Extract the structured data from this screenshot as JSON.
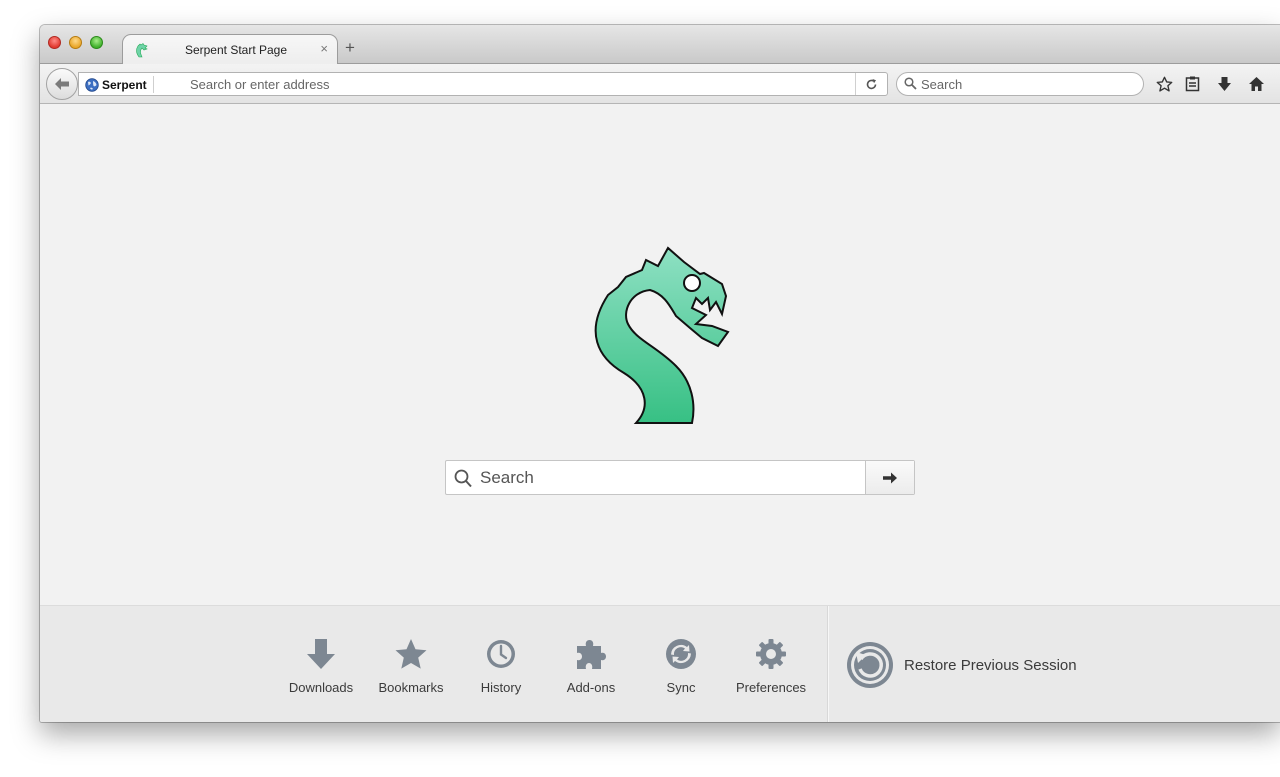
{
  "tab": {
    "title": "Serpent Start Page",
    "close_glyph": "×",
    "new_tab_glyph": "+"
  },
  "navbar": {
    "identity_label": "Serpent",
    "url_placeholder": "Search or enter address",
    "search_placeholder": "Search"
  },
  "content": {
    "search_placeholder": "Search"
  },
  "launcher": {
    "items": [
      {
        "label": "Downloads",
        "icon": "download-icon"
      },
      {
        "label": "Bookmarks",
        "icon": "star-icon"
      },
      {
        "label": "History",
        "icon": "clock-icon"
      },
      {
        "label": "Add-ons",
        "icon": "puzzle-icon"
      },
      {
        "label": "Sync",
        "icon": "sync-icon"
      },
      {
        "label": "Preferences",
        "icon": "gear-icon"
      }
    ],
    "restore_label": "Restore Previous Session"
  },
  "colors": {
    "logo_green_top": "#8ee0c3",
    "logo_green_bottom": "#37c084",
    "icon_gray": "#7d8792"
  }
}
